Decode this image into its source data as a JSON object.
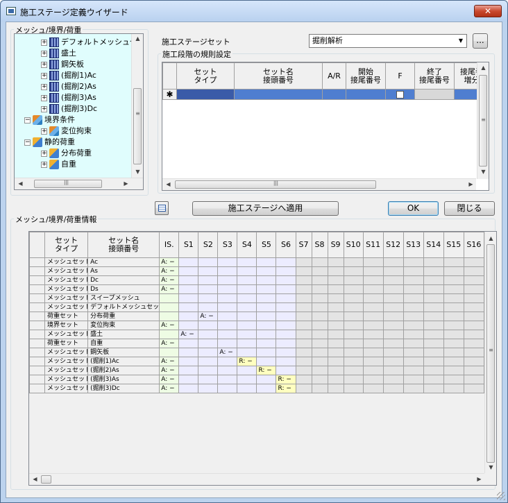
{
  "window": {
    "title": "施工ステージ定義ウイザード",
    "close_label": "✕"
  },
  "tree_group": {
    "label": "メッシュ/境界/荷重"
  },
  "tree": {
    "items": [
      {
        "label": "デフォルトメッシュセット",
        "icon": "mesh-set-icon",
        "pm": "+"
      },
      {
        "label": "盛土",
        "icon": "mesh-set-icon",
        "pm": "+"
      },
      {
        "label": "鋼矢板",
        "icon": "mesh-set-icon",
        "pm": "+"
      },
      {
        "label": "(掘削1)Ac",
        "icon": "mesh-set-icon",
        "pm": "+"
      },
      {
        "label": "(掘削2)As",
        "icon": "mesh-set-icon",
        "pm": "+"
      },
      {
        "label": "(掘削3)As",
        "icon": "mesh-set-icon",
        "pm": "+"
      },
      {
        "label": "(掘削3)Dc",
        "icon": "mesh-set-icon",
        "pm": "+"
      },
      {
        "label": "境界条件",
        "icon": "boundary-condition-icon",
        "pm": "−"
      },
      {
        "label": "変位拘束",
        "icon": "boundary-set-icon",
        "pm": "+"
      },
      {
        "label": "静的荷重",
        "icon": "static-load-icon",
        "pm": "−"
      },
      {
        "label": "分布荷重",
        "icon": "load-set-icon",
        "pm": "+"
      },
      {
        "label": "自重",
        "icon": "load-set-icon",
        "pm": "+"
      }
    ]
  },
  "stage_set": {
    "label": "施工ステージセット",
    "selected": "掘削解析",
    "more_label": "..."
  },
  "rules_group": {
    "label": "施工段階の規則設定"
  },
  "rules_table": {
    "headers": [
      {
        "line1": "セット",
        "line2": "タイプ"
      },
      {
        "line1": "セット名",
        "line2": "接頭番号"
      },
      {
        "line1": "A/R",
        "line2": ""
      },
      {
        "line1": "開始",
        "line2": "接尾番号"
      },
      {
        "line1": "F",
        "line2": ""
      },
      {
        "line1": "終了",
        "line2": "接尾番号"
      },
      {
        "line1": "接尾番",
        "line2": "増分"
      }
    ],
    "new_row_marker": "✱"
  },
  "buttons": {
    "apply": "施工ステージへ適用",
    "ok": "OK",
    "close": "閉じる"
  },
  "info_group": {
    "label": "メッシュ/境界/荷重情報"
  },
  "info_table": {
    "headers": {
      "set_type_1": "セット",
      "set_type_2": "タイプ",
      "set_name_1": "セット名",
      "set_name_2": "接頭番号",
      "stages": [
        "IS.",
        "S1",
        "S2",
        "S3",
        "S4",
        "S5",
        "S6",
        "S7",
        "S8",
        "S9",
        "S10",
        "S11",
        "S12",
        "S13",
        "S14",
        "S15",
        "S16"
      ]
    },
    "rows": [
      {
        "type": "メッシュセット",
        "name": "Ac",
        "cells": {
          "0": "A: −"
        }
      },
      {
        "type": "メッシュセット",
        "name": "As",
        "cells": {
          "0": "A: −"
        }
      },
      {
        "type": "メッシュセット",
        "name": "Dc",
        "cells": {
          "0": "A: −"
        }
      },
      {
        "type": "メッシュセット",
        "name": "Ds",
        "cells": {
          "0": "A: −"
        }
      },
      {
        "type": "メッシュセット",
        "name": "スイープメッシュ",
        "cells": {}
      },
      {
        "type": "メッシュセット",
        "name": "デフォルトメッシュセット",
        "cells": {}
      },
      {
        "type": "荷重セット",
        "name": "分布荷重",
        "cells": {
          "2": "A: −"
        }
      },
      {
        "type": "境界セット",
        "name": "変位拘束",
        "cells": {
          "0": "A: −"
        }
      },
      {
        "type": "メッシュセット",
        "name": "盛土",
        "cells": {
          "1": "A: −"
        }
      },
      {
        "type": "荷重セット",
        "name": "自重",
        "cells": {
          "0": "A: −"
        }
      },
      {
        "type": "メッシュセット",
        "name": "鋼矢板",
        "cells": {
          "3": "A: −"
        }
      },
      {
        "type": "メッシュセット",
        "name": "(掘削1)Ac",
        "cells": {
          "0": "A: −",
          "4": "R: −"
        }
      },
      {
        "type": "メッシュセット",
        "name": "(掘削2)As",
        "cells": {
          "0": "A: −",
          "5": "R: −"
        }
      },
      {
        "type": "メッシュセット",
        "name": "(掘削3)As",
        "cells": {
          "0": "A: −",
          "6": "R: −"
        }
      },
      {
        "type": "メッシュセット",
        "name": "(掘削3)Dc",
        "cells": {
          "0": "A: −",
          "6": "R: −"
        }
      }
    ]
  },
  "scroll_arrows": {
    "up": "▲",
    "down": "▼",
    "left": "◀",
    "right": "▶",
    "grip": "≡",
    "hgrip": "|||"
  }
}
